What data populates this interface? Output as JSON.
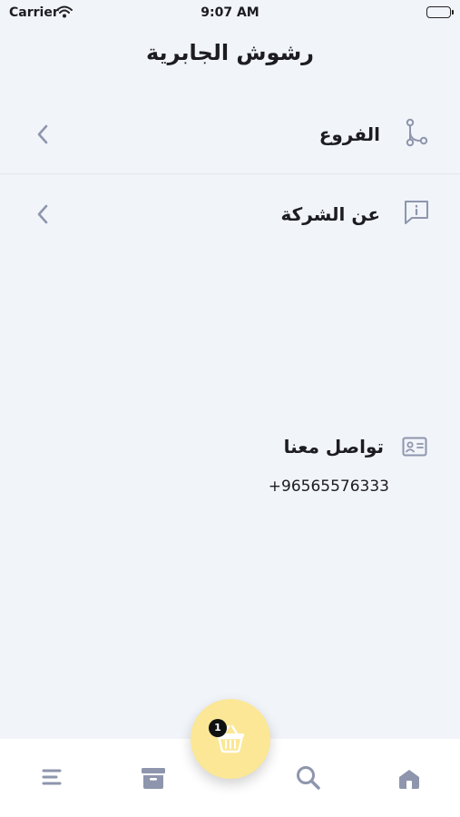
{
  "status_bar": {
    "carrier": "Carrier",
    "time": "9:07 AM"
  },
  "header": {
    "title": "رشوش الجابرية"
  },
  "menu": {
    "items": [
      {
        "label": "الفروع",
        "icon": "branch-icon"
      },
      {
        "label": "عن الشركة",
        "icon": "info-message-icon"
      }
    ]
  },
  "contact": {
    "title": "تواصل معنا",
    "icon": "contact-card-icon",
    "phone": "+96565576333"
  },
  "tab_bar": {
    "items": [
      "menu-icon",
      "archive-icon",
      "search-icon",
      "home-icon"
    ],
    "cart_badge": "1"
  },
  "colors": {
    "background": "#f1f4f9",
    "icon_gray": "#8e96ad",
    "fab": "#fbe795"
  }
}
